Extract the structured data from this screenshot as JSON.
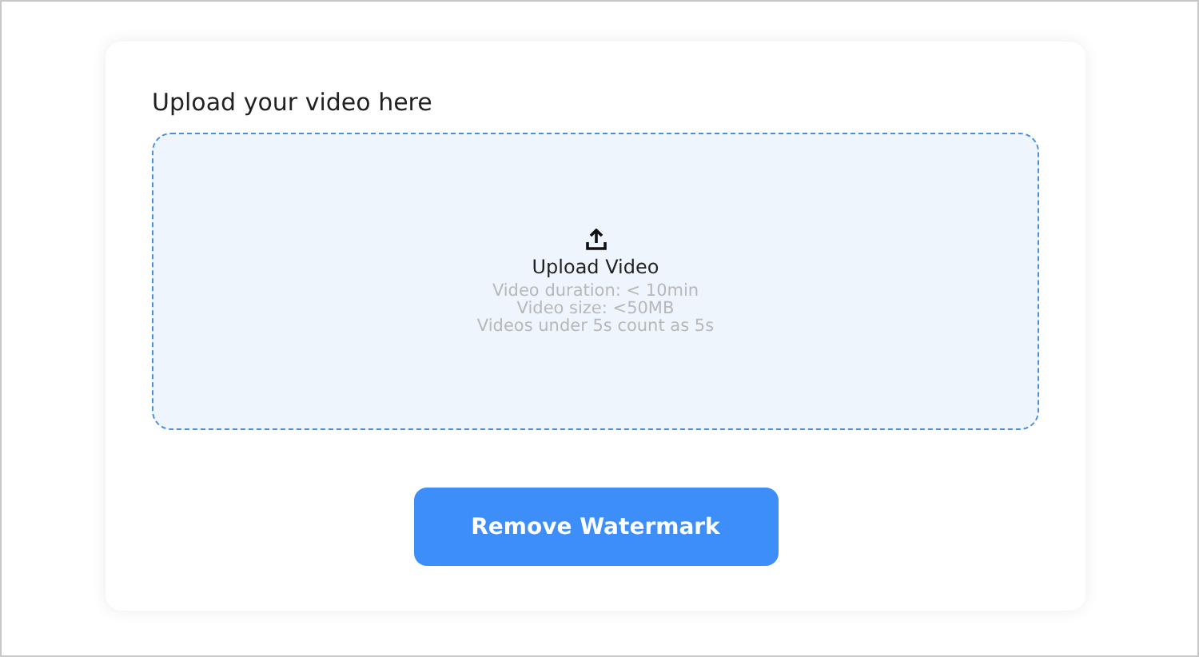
{
  "heading": "Upload your video here",
  "dropzone": {
    "label": "Upload Video",
    "notes": [
      "Video duration: < 10min",
      "Video size: <50MB",
      "Videos under 5s count as 5s"
    ]
  },
  "button": "Remove Watermark"
}
